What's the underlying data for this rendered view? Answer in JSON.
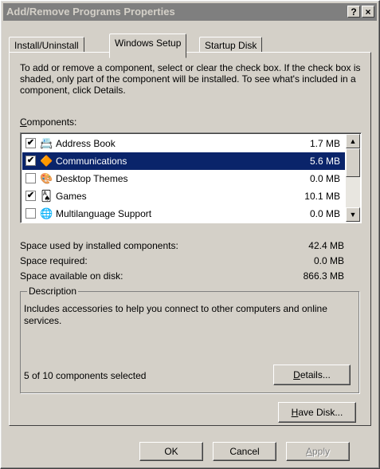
{
  "window": {
    "title": "Add/Remove Programs Properties",
    "help_label": "?",
    "close_label": "×"
  },
  "tabs": [
    {
      "label": "Install/Uninstall"
    },
    {
      "label": "Windows Setup"
    },
    {
      "label": "Startup Disk"
    }
  ],
  "intro": "To add or remove a component, select or clear the check box. If the check box is shaded, only part of the component will be installed. To see what's included in a component, click Details.",
  "components_label": {
    "first": "C",
    "rest": "omponents:"
  },
  "components": [
    {
      "name": "Address Book",
      "size": "1.7 MB",
      "checked": "✔",
      "icon": "address-book-icon",
      "glyph": "📇"
    },
    {
      "name": "Communications",
      "size": "5.6 MB",
      "checked": "✔",
      "icon": "communications-icon",
      "glyph": "🔶"
    },
    {
      "name": "Desktop Themes",
      "size": "0.0 MB",
      "checked": "",
      "icon": "desktop-themes-icon",
      "glyph": "🎨"
    },
    {
      "name": "Games",
      "size": "10.1 MB",
      "checked": "✔",
      "icon": "games-icon",
      "glyph": "🂡"
    },
    {
      "name": "Multilanguage Support",
      "size": "0.0 MB",
      "checked": "",
      "icon": "globe-icon",
      "glyph": "🌐"
    }
  ],
  "scroll": {
    "up": "▲",
    "down": "▼"
  },
  "space": [
    {
      "label": "Space used by installed components:",
      "value": "42.4 MB"
    },
    {
      "label": "Space required:",
      "value": "0.0 MB"
    },
    {
      "label": "Space available on disk:",
      "value": "866.3 MB"
    }
  ],
  "description": {
    "legend": "Description",
    "text": "Includes accessories to help you connect to other computers and online services.",
    "selected_count": "5 of 10 components selected"
  },
  "buttons": {
    "details": {
      "first": "D",
      "rest": "etails..."
    },
    "have_disk": {
      "first": "H",
      "rest": "ave Disk..."
    },
    "ok": "OK",
    "cancel": "Cancel",
    "apply": {
      "first": "A",
      "rest": "pply"
    }
  }
}
